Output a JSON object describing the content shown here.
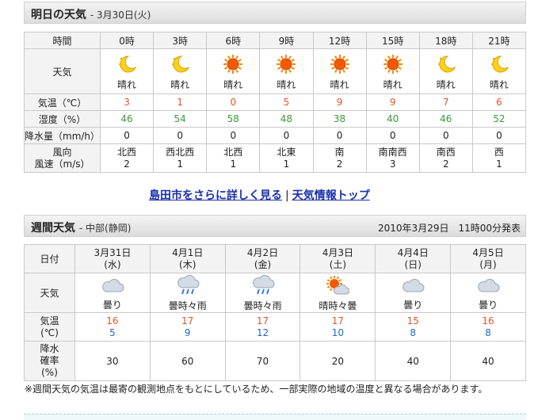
{
  "tomorrow": {
    "title": "明日の天気",
    "date": "- 3月30日(火)",
    "labels": {
      "time": "時間",
      "weather": "天気",
      "temp": "気温（℃）",
      "humidity": "湿度（%）",
      "rain": "降水量（mm/h）",
      "wind_dir": "風向",
      "wind_speed": "風速（m/s）"
    },
    "hours": [
      {
        "time": "0時",
        "icon": "moon-icon",
        "weather": "晴れ",
        "temp": "3",
        "humidity": "46",
        "rain": "0",
        "wind_dir": "北西",
        "wind_speed": "2"
      },
      {
        "time": "3時",
        "icon": "moon-icon",
        "weather": "晴れ",
        "temp": "1",
        "humidity": "54",
        "rain": "0",
        "wind_dir": "西北西",
        "wind_speed": "1"
      },
      {
        "time": "6時",
        "icon": "sun-icon",
        "weather": "晴れ",
        "temp": "0",
        "humidity": "58",
        "rain": "0",
        "wind_dir": "北西",
        "wind_speed": "1"
      },
      {
        "time": "9時",
        "icon": "sun-icon",
        "weather": "晴れ",
        "temp": "5",
        "humidity": "48",
        "rain": "0",
        "wind_dir": "北東",
        "wind_speed": "1"
      },
      {
        "time": "12時",
        "icon": "sun-icon",
        "weather": "晴れ",
        "temp": "9",
        "humidity": "38",
        "rain": "0",
        "wind_dir": "南",
        "wind_speed": "2"
      },
      {
        "time": "15時",
        "icon": "sun-icon",
        "weather": "晴れ",
        "temp": "9",
        "humidity": "40",
        "rain": "0",
        "wind_dir": "南南西",
        "wind_speed": "3"
      },
      {
        "time": "18時",
        "icon": "moon-icon",
        "weather": "晴れ",
        "temp": "7",
        "humidity": "46",
        "rain": "0",
        "wind_dir": "南西",
        "wind_speed": "2"
      },
      {
        "time": "21時",
        "icon": "moon-icon",
        "weather": "晴れ",
        "temp": "6",
        "humidity": "52",
        "rain": "0",
        "wind_dir": "西",
        "wind_speed": "1"
      }
    ]
  },
  "links": {
    "detail": "島田市をさらに詳しく見る",
    "separator": "|",
    "top": "天気情報トップ"
  },
  "weekly": {
    "title": "週間天気",
    "region": "- 中部(静岡)",
    "issued": "2010年3月29日　11時00分発表",
    "labels": {
      "date": "日付",
      "weather": "天気",
      "temp_line1": "気温",
      "temp_line2": "(℃)",
      "rain_line1": "降水",
      "rain_line2": "確率",
      "rain_line3": "(%)"
    },
    "days": [
      {
        "date": "3月31日",
        "dow": "(水)",
        "icon": "cloud-icon",
        "weather": "曇り",
        "high": "16",
        "low": "5",
        "rain": "30"
      },
      {
        "date": "4月1日",
        "dow": "(木)",
        "icon": "cloud-rain-icon",
        "weather": "曇時々雨",
        "high": "17",
        "low": "9",
        "rain": "60"
      },
      {
        "date": "4月2日",
        "dow": "(金)",
        "icon": "cloud-rain-icon",
        "weather": "曇時々雨",
        "high": "17",
        "low": "12",
        "rain": "70"
      },
      {
        "date": "4月3日",
        "dow": "(土)",
        "icon": "sun-cloud-icon",
        "weather": "晴時々曇",
        "high": "17",
        "low": "10",
        "rain": "20"
      },
      {
        "date": "4月4日",
        "dow": "(日)",
        "icon": "cloud-icon",
        "weather": "曇り",
        "high": "15",
        "low": "8",
        "rain": "40"
      },
      {
        "date": "4月5日",
        "dow": "(月)",
        "icon": "cloud-icon",
        "weather": "曇り",
        "high": "16",
        "low": "8",
        "rain": "40"
      }
    ]
  },
  "note": "※週間天気の気温は最寄の観測地点をもとにしているため、一部実際の地域の温度と異なる場合があります。",
  "colors": {
    "temp": "#e0552a",
    "humidity": "#3a9a3a",
    "low_temp": "#2266cc",
    "link": "#1a2fa8"
  }
}
